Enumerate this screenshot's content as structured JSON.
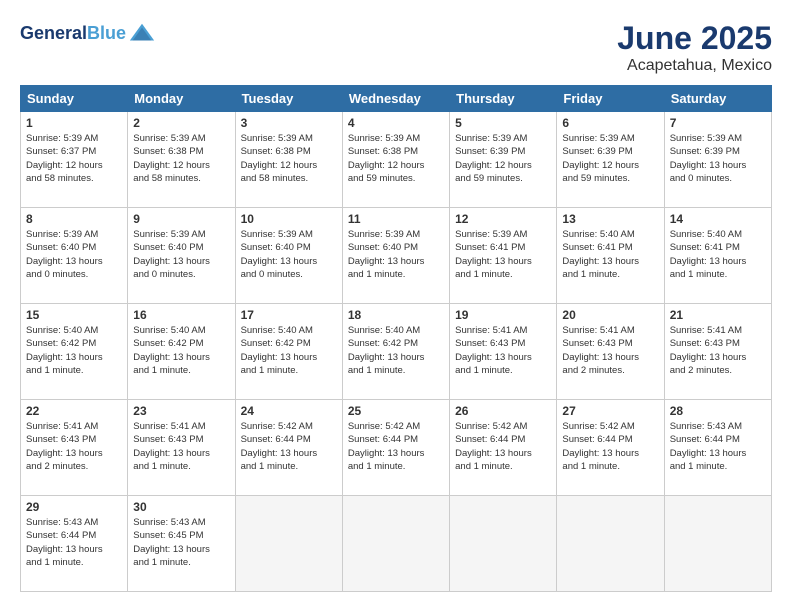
{
  "logo": {
    "line1": "General",
    "line2": "Blue"
  },
  "title": "June 2025",
  "subtitle": "Acapetahua, Mexico",
  "headers": [
    "Sunday",
    "Monday",
    "Tuesday",
    "Wednesday",
    "Thursday",
    "Friday",
    "Saturday"
  ],
  "weeks": [
    [
      {
        "day": "1",
        "detail": "Sunrise: 5:39 AM\nSunset: 6:37 PM\nDaylight: 12 hours\nand 58 minutes."
      },
      {
        "day": "2",
        "detail": "Sunrise: 5:39 AM\nSunset: 6:38 PM\nDaylight: 12 hours\nand 58 minutes."
      },
      {
        "day": "3",
        "detail": "Sunrise: 5:39 AM\nSunset: 6:38 PM\nDaylight: 12 hours\nand 58 minutes."
      },
      {
        "day": "4",
        "detail": "Sunrise: 5:39 AM\nSunset: 6:38 PM\nDaylight: 12 hours\nand 59 minutes."
      },
      {
        "day": "5",
        "detail": "Sunrise: 5:39 AM\nSunset: 6:39 PM\nDaylight: 12 hours\nand 59 minutes."
      },
      {
        "day": "6",
        "detail": "Sunrise: 5:39 AM\nSunset: 6:39 PM\nDaylight: 12 hours\nand 59 minutes."
      },
      {
        "day": "7",
        "detail": "Sunrise: 5:39 AM\nSunset: 6:39 PM\nDaylight: 13 hours\nand 0 minutes."
      }
    ],
    [
      {
        "day": "8",
        "detail": "Sunrise: 5:39 AM\nSunset: 6:40 PM\nDaylight: 13 hours\nand 0 minutes."
      },
      {
        "day": "9",
        "detail": "Sunrise: 5:39 AM\nSunset: 6:40 PM\nDaylight: 13 hours\nand 0 minutes."
      },
      {
        "day": "10",
        "detail": "Sunrise: 5:39 AM\nSunset: 6:40 PM\nDaylight: 13 hours\nand 0 minutes."
      },
      {
        "day": "11",
        "detail": "Sunrise: 5:39 AM\nSunset: 6:40 PM\nDaylight: 13 hours\nand 1 minute."
      },
      {
        "day": "12",
        "detail": "Sunrise: 5:39 AM\nSunset: 6:41 PM\nDaylight: 13 hours\nand 1 minute."
      },
      {
        "day": "13",
        "detail": "Sunrise: 5:40 AM\nSunset: 6:41 PM\nDaylight: 13 hours\nand 1 minute."
      },
      {
        "day": "14",
        "detail": "Sunrise: 5:40 AM\nSunset: 6:41 PM\nDaylight: 13 hours\nand 1 minute."
      }
    ],
    [
      {
        "day": "15",
        "detail": "Sunrise: 5:40 AM\nSunset: 6:42 PM\nDaylight: 13 hours\nand 1 minute."
      },
      {
        "day": "16",
        "detail": "Sunrise: 5:40 AM\nSunset: 6:42 PM\nDaylight: 13 hours\nand 1 minute."
      },
      {
        "day": "17",
        "detail": "Sunrise: 5:40 AM\nSunset: 6:42 PM\nDaylight: 13 hours\nand 1 minute."
      },
      {
        "day": "18",
        "detail": "Sunrise: 5:40 AM\nSunset: 6:42 PM\nDaylight: 13 hours\nand 1 minute."
      },
      {
        "day": "19",
        "detail": "Sunrise: 5:41 AM\nSunset: 6:43 PM\nDaylight: 13 hours\nand 1 minute."
      },
      {
        "day": "20",
        "detail": "Sunrise: 5:41 AM\nSunset: 6:43 PM\nDaylight: 13 hours\nand 2 minutes."
      },
      {
        "day": "21",
        "detail": "Sunrise: 5:41 AM\nSunset: 6:43 PM\nDaylight: 13 hours\nand 2 minutes."
      }
    ],
    [
      {
        "day": "22",
        "detail": "Sunrise: 5:41 AM\nSunset: 6:43 PM\nDaylight: 13 hours\nand 2 minutes."
      },
      {
        "day": "23",
        "detail": "Sunrise: 5:41 AM\nSunset: 6:43 PM\nDaylight: 13 hours\nand 1 minute."
      },
      {
        "day": "24",
        "detail": "Sunrise: 5:42 AM\nSunset: 6:44 PM\nDaylight: 13 hours\nand 1 minute."
      },
      {
        "day": "25",
        "detail": "Sunrise: 5:42 AM\nSunset: 6:44 PM\nDaylight: 13 hours\nand 1 minute."
      },
      {
        "day": "26",
        "detail": "Sunrise: 5:42 AM\nSunset: 6:44 PM\nDaylight: 13 hours\nand 1 minute."
      },
      {
        "day": "27",
        "detail": "Sunrise: 5:42 AM\nSunset: 6:44 PM\nDaylight: 13 hours\nand 1 minute."
      },
      {
        "day": "28",
        "detail": "Sunrise: 5:43 AM\nSunset: 6:44 PM\nDaylight: 13 hours\nand 1 minute."
      }
    ],
    [
      {
        "day": "29",
        "detail": "Sunrise: 5:43 AM\nSunset: 6:44 PM\nDaylight: 13 hours\nand 1 minute."
      },
      {
        "day": "30",
        "detail": "Sunrise: 5:43 AM\nSunset: 6:45 PM\nDaylight: 13 hours\nand 1 minute."
      },
      {
        "day": "",
        "detail": ""
      },
      {
        "day": "",
        "detail": ""
      },
      {
        "day": "",
        "detail": ""
      },
      {
        "day": "",
        "detail": ""
      },
      {
        "day": "",
        "detail": ""
      }
    ]
  ]
}
